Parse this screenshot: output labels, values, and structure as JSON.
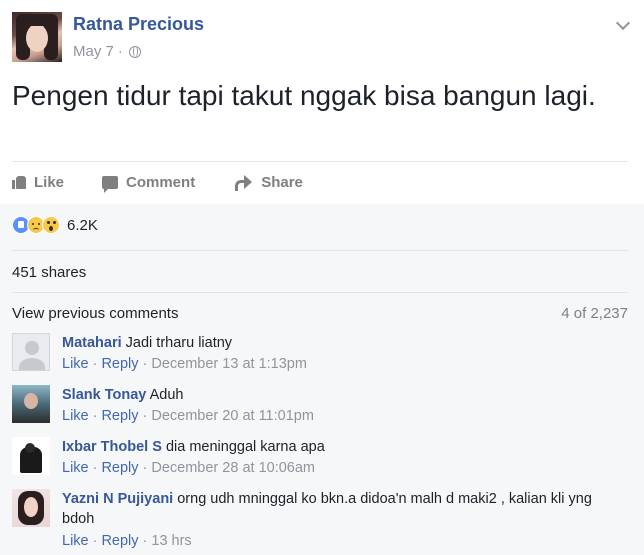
{
  "post": {
    "author": "Ratna Precious",
    "date": "May 7",
    "privacy_icon": "globe-icon",
    "text": "Pengen tidur tapi takut nggak bisa bangun lagi."
  },
  "actions": {
    "like": "Like",
    "comment": "Comment",
    "share": "Share"
  },
  "reactions": {
    "types": [
      "like",
      "sad",
      "wow"
    ],
    "count": "6.2K"
  },
  "shares": "451 shares",
  "comments_header": {
    "view_previous": "View previous comments",
    "count": "4 of 2,237"
  },
  "comment_actions": {
    "like": "Like",
    "reply": "Reply",
    "separator": "·"
  },
  "comments": [
    {
      "author": "Matahari",
      "text": "Jadi trharu liatny",
      "time": "December 13 at 1:13pm"
    },
    {
      "author": "Slank Tonay",
      "text": "Aduh",
      "time": "December 20 at 11:01pm"
    },
    {
      "author": "Ixbar Thobel S",
      "text": "dia meninggal karna apa",
      "time": "December 28 at 10:06am"
    },
    {
      "author": "Yazni N Pujiyani",
      "text": "orng udh mninggal ko bkn.a didoa'n malh d maki2 , kalian kli yng bdoh",
      "time": "13 hrs"
    }
  ]
}
